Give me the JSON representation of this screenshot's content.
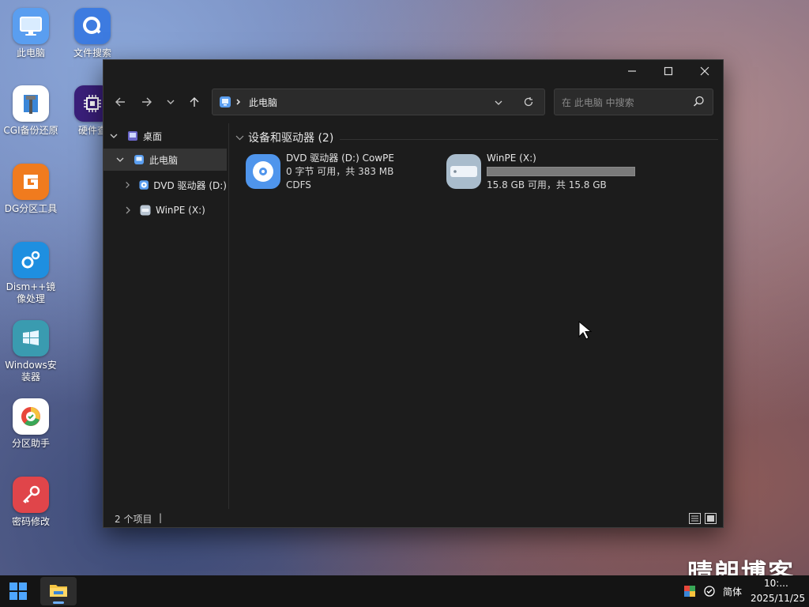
{
  "desktop": {
    "icons": [
      {
        "label": "此电脑",
        "color": "#4d8fe0"
      },
      {
        "label": "文件搜索",
        "color": "#3d7be0"
      },
      {
        "label": "CGI备份还原",
        "color": "#ffffff"
      },
      {
        "label": "硬件查",
        "color": "#3a1f7a"
      },
      {
        "label": "DG分区工具",
        "color": "#f07b1e"
      },
      {
        "label": "Dism++镜像处理",
        "color": "#1e8fe0"
      },
      {
        "label": "Windows安装器",
        "color": "#3a9bb0"
      },
      {
        "label": "分区助手",
        "color": "#ffffff"
      },
      {
        "label": "密码修改",
        "color": "#e0454a"
      }
    ]
  },
  "explorer": {
    "address": {
      "location": "此电脑"
    },
    "search": {
      "placeholder": "在 此电脑 中搜索"
    },
    "tree": [
      {
        "label": "桌面"
      },
      {
        "label": "此电脑"
      },
      {
        "label": "DVD 驱动器 (D:)"
      },
      {
        "label": "WinPE (X:)"
      }
    ],
    "group_header": "设备和驱动器 (2)",
    "drives": [
      {
        "name": "DVD 驱动器 (D:) CowPE",
        "free_text": "0 字节 可用，共 383 MB",
        "fs": "CDFS"
      },
      {
        "name": "WinPE (X:)",
        "free_text": "15.8 GB 可用，共 15.8 GB",
        "used_fraction": 0.0
      }
    ],
    "status": {
      "item_count": "2 个项目"
    }
  },
  "taskbar": {
    "ime": "简体",
    "date": "2025/11/25",
    "time": "10:..."
  },
  "watermark": "晴朗博客"
}
